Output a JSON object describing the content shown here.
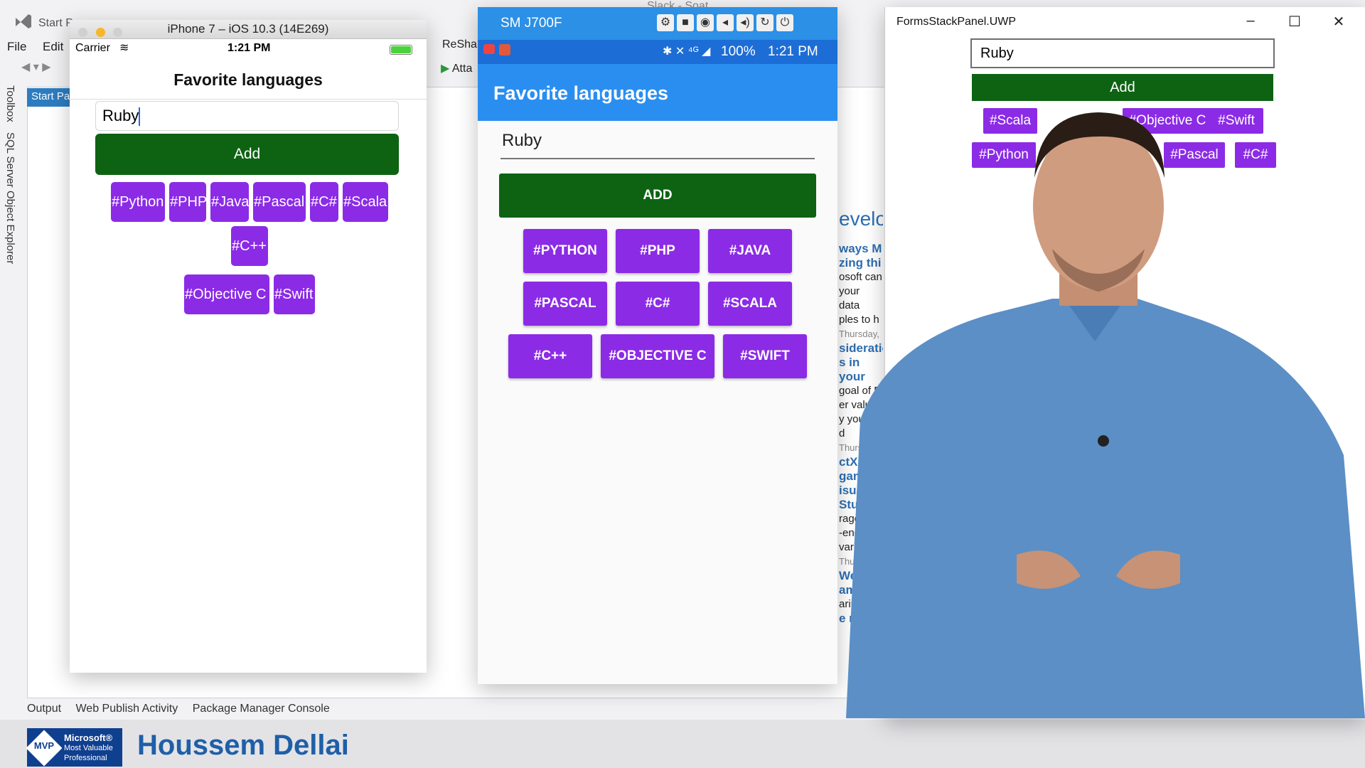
{
  "vs": {
    "title_fragment": "Start P",
    "menu": [
      "File",
      "Edit"
    ],
    "side_tools": [
      "Toolbox",
      "SQL Server Object Explorer"
    ],
    "start_tab": "Start Pa",
    "resharper": "ReShar",
    "attach": "Atta",
    "top_center": "Slack - Soat",
    "news": [
      {
        "kind": "blue",
        "text": "evelo"
      },
      {
        "kind": "blue",
        "text": "ways M"
      },
      {
        "kind": "blue",
        "text": "zing thi"
      },
      {
        "kind": "text",
        "text": "osoft can"
      },
      {
        "kind": "text",
        "text": "your data"
      },
      {
        "kind": "text",
        "text": "ples to h"
      },
      {
        "kind": "gray",
        "text": "Thursday,"
      },
      {
        "kind": "blue",
        "text": "sideratio"
      },
      {
        "kind": "blue",
        "text": "s in your"
      },
      {
        "kind": "text",
        "text": "goal of D"
      },
      {
        "kind": "text",
        "text": "er value."
      },
      {
        "kind": "text",
        "text": "y you to d"
      },
      {
        "kind": "gray",
        "text": "Thursday,"
      },
      {
        "kind": "blue",
        "text": "ctX gam"
      },
      {
        "kind": "blue",
        "text": "isual Stu"
      },
      {
        "kind": "text",
        "text": "rage the"
      },
      {
        "kind": "text",
        "text": "-end ga"
      },
      {
        "kind": "text",
        "text": "variety"
      },
      {
        "kind": "gray",
        "text": "Thurs"
      },
      {
        "kind": "blue",
        "text": "We"
      },
      {
        "kind": "blue",
        "text": "am"
      },
      {
        "kind": "text",
        "text": "arin"
      },
      {
        "kind": "blue",
        "text": "e news"
      }
    ],
    "bottom_tabs": [
      "Output",
      "Web Publish Activity",
      "Package Manager Console"
    ]
  },
  "ios": {
    "window_title": "iPhone 7 – iOS 10.3 (14E269)",
    "carrier": "Carrier",
    "time": "1:21 PM",
    "nav_title": "Favorite languages",
    "entry_value": "Ruby",
    "add_label": "Add",
    "tags_row1": [
      "#Python",
      "#PHP",
      "#Java",
      "#Pascal",
      "#C#",
      "#Scala",
      "#C++"
    ],
    "tags_row2": [
      "#Objective C",
      "#Swift"
    ]
  },
  "android": {
    "device_name": "SM J700F",
    "battery": "100%",
    "time": "1:21 PM",
    "app_title": "Favorite languages",
    "entry_value": "Ruby",
    "add_label": "ADD",
    "tag_rows": [
      [
        "#PYTHON",
        "#PHP",
        "#JAVA"
      ],
      [
        "#PASCAL",
        "#C#",
        "#SCALA"
      ],
      [
        "#C++",
        "#OBJECTIVE C",
        "#SWIFT"
      ]
    ]
  },
  "uwp": {
    "window_title": "FormsStackPanel.UWP",
    "entry_value": "Ruby",
    "add_label": "Add",
    "tags_row1": [
      "#Scala",
      "#Objective C",
      "#Swift"
    ],
    "tags_row2": [
      "#Python",
      "#Pascal",
      "#C#"
    ]
  },
  "lower_third": {
    "mvp_badge": "MVP",
    "mvp_line1": "Microsoft®",
    "mvp_line2": "Most Valuable",
    "mvp_line3": "Professional",
    "presenter_name": "Houssem Dellai"
  },
  "colors": {
    "add_green": "#0d6312",
    "tag_purple": "#8b2be6",
    "android_bar": "#2a8ef0",
    "name_blue": "#1f5fa8"
  }
}
